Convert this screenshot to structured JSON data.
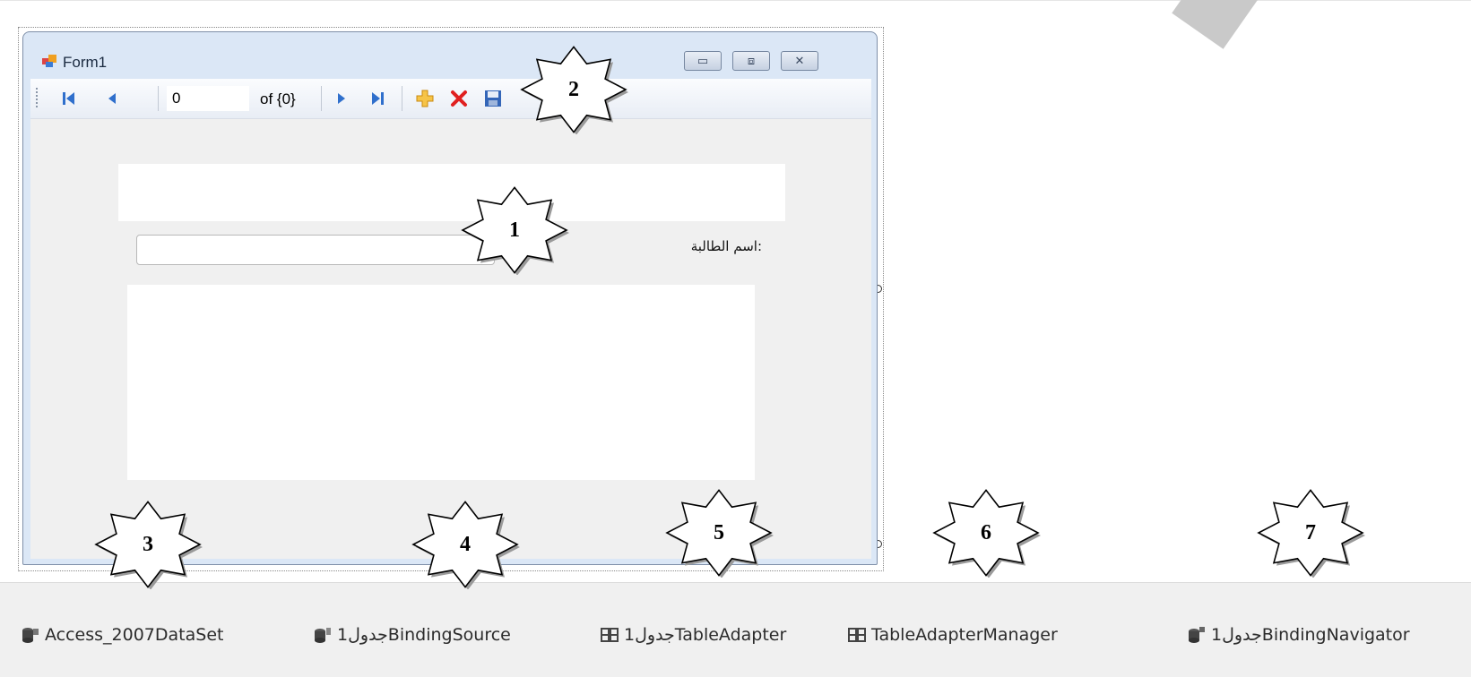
{
  "form": {
    "title": "Form1",
    "icon": "form-icon",
    "window_buttons": [
      "minimize",
      "maximize",
      "close"
    ]
  },
  "navigator": {
    "position_value": "0",
    "count_label": "of {0}",
    "icons": [
      "move-first-icon",
      "move-previous-icon",
      "move-next-icon",
      "move-last-icon",
      "add-new-icon",
      "delete-icon",
      "save-icon"
    ]
  },
  "fields": {
    "student_name_label": ":اسم الطالبة"
  },
  "tray": {
    "items": [
      {
        "label": "Access_2007DataSet",
        "icon": "dataset-icon"
      },
      {
        "label": "جدول1BindingSource",
        "icon": "binding-source-icon"
      },
      {
        "label": "جدول1TableAdapter",
        "icon": "table-adapter-icon"
      },
      {
        "label": "TableAdapterManager",
        "icon": "table-adapter-manager-icon"
      },
      {
        "label": "جدول1BindingNavigator",
        "icon": "binding-navigator-icon"
      }
    ]
  },
  "callouts": [
    "1",
    "2",
    "3",
    "4",
    "5",
    "6",
    "7"
  ],
  "colors": {
    "form_border": "#7e8fa8",
    "form_frame": "#dbe7f6",
    "client_bg": "#f0f0f0",
    "add_icon": "#f0b030",
    "delete_icon": "#e02020",
    "nav_arrow": "#2f6fcc"
  }
}
